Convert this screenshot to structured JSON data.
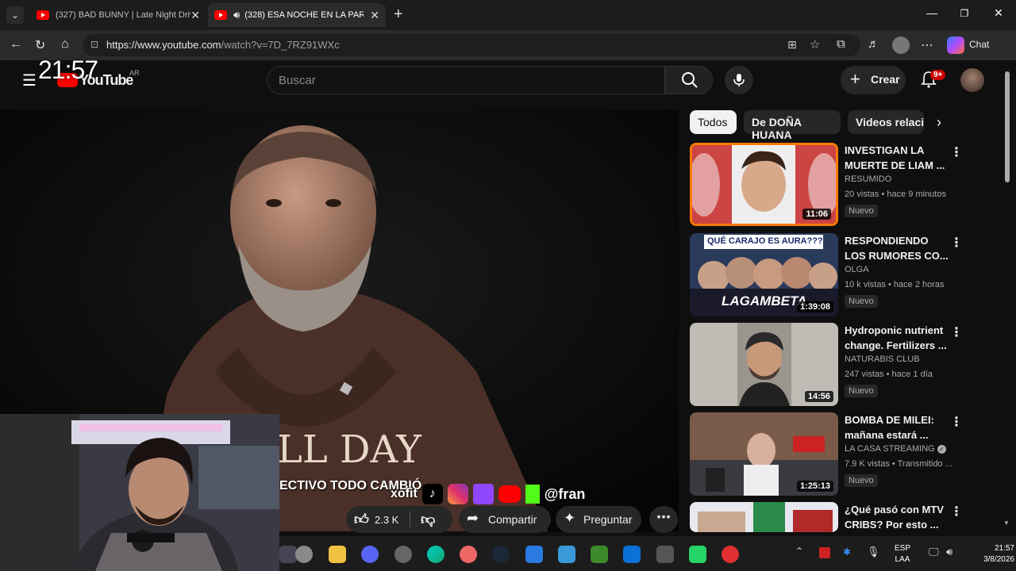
{
  "browser": {
    "tabs": [
      {
        "title": "(327) BAD BUNNY | Late Night Driv",
        "active": false
      },
      {
        "title": "(328) ESA NOCHE EN LA PARA",
        "active": true
      }
    ],
    "url_host": "https://www.youtube.com",
    "url_path": "/watch?v=7D_7RZ91WXc",
    "chat_label": "Chat"
  },
  "overlay": {
    "clock": "21:57"
  },
  "youtube": {
    "logo_text": "YouTube",
    "country": "AR",
    "search_placeholder": "Buscar",
    "create_label": "Crear",
    "notif_badge": "9+"
  },
  "video": {
    "caption": "ECTIVO TODO CAMBIÓ",
    "overlay_handle": "@fran",
    "overlay_prefix": "xofit",
    "shirt_text": "LL DAY"
  },
  "actions": {
    "likes": "2.3 K",
    "share_label": "Compartir",
    "ask_label": "Preguntar"
  },
  "chips": [
    {
      "label": "Todos",
      "selected": true
    },
    {
      "label": "De DOÑA HUANA",
      "selected": false
    },
    {
      "label": "Videos relaci",
      "selected": false
    }
  ],
  "recommendations": [
    {
      "title": "INVESTIGAN LA MUERTE DE LIAM ...",
      "channel": "RESUMIDO",
      "meta": "20 vistas • hace 9 minutos",
      "badge": "Nuevo",
      "duration": "11:06"
    },
    {
      "title": "RESPONDIENDO LOS RUMORES CO...",
      "channel": "OLGA",
      "meta": "10 k vistas • hace 2 horas",
      "badge": "Nuevo",
      "duration": "1:39:08",
      "thumb_text": "QUÉ CARAJO ES AURA???",
      "thumb_text2": "LAGAMBETA"
    },
    {
      "title": "Hydroponic nutrient change. Fertilizers ...",
      "channel": "NATURABIS CLUB",
      "meta": "247 vistas • hace 1 día",
      "badge": "Nuevo",
      "duration": "14:56"
    },
    {
      "title": "BOMBA DE MILEI: mañana estará ...",
      "channel": "LA CASA STREAMING",
      "meta": "7.9 K vistas • Transmitido ...",
      "badge": "Nuevo",
      "duration": "1:25:13"
    },
    {
      "title": "¿Qué pasó con MTV CRIBS? Por esto ...",
      "channel": "",
      "meta": "",
      "badge": "",
      "duration": ""
    }
  ],
  "taskbar": {
    "lang1": "ESP",
    "lang2": "LAA",
    "time": "21:57",
    "date": "3/8/2026"
  }
}
